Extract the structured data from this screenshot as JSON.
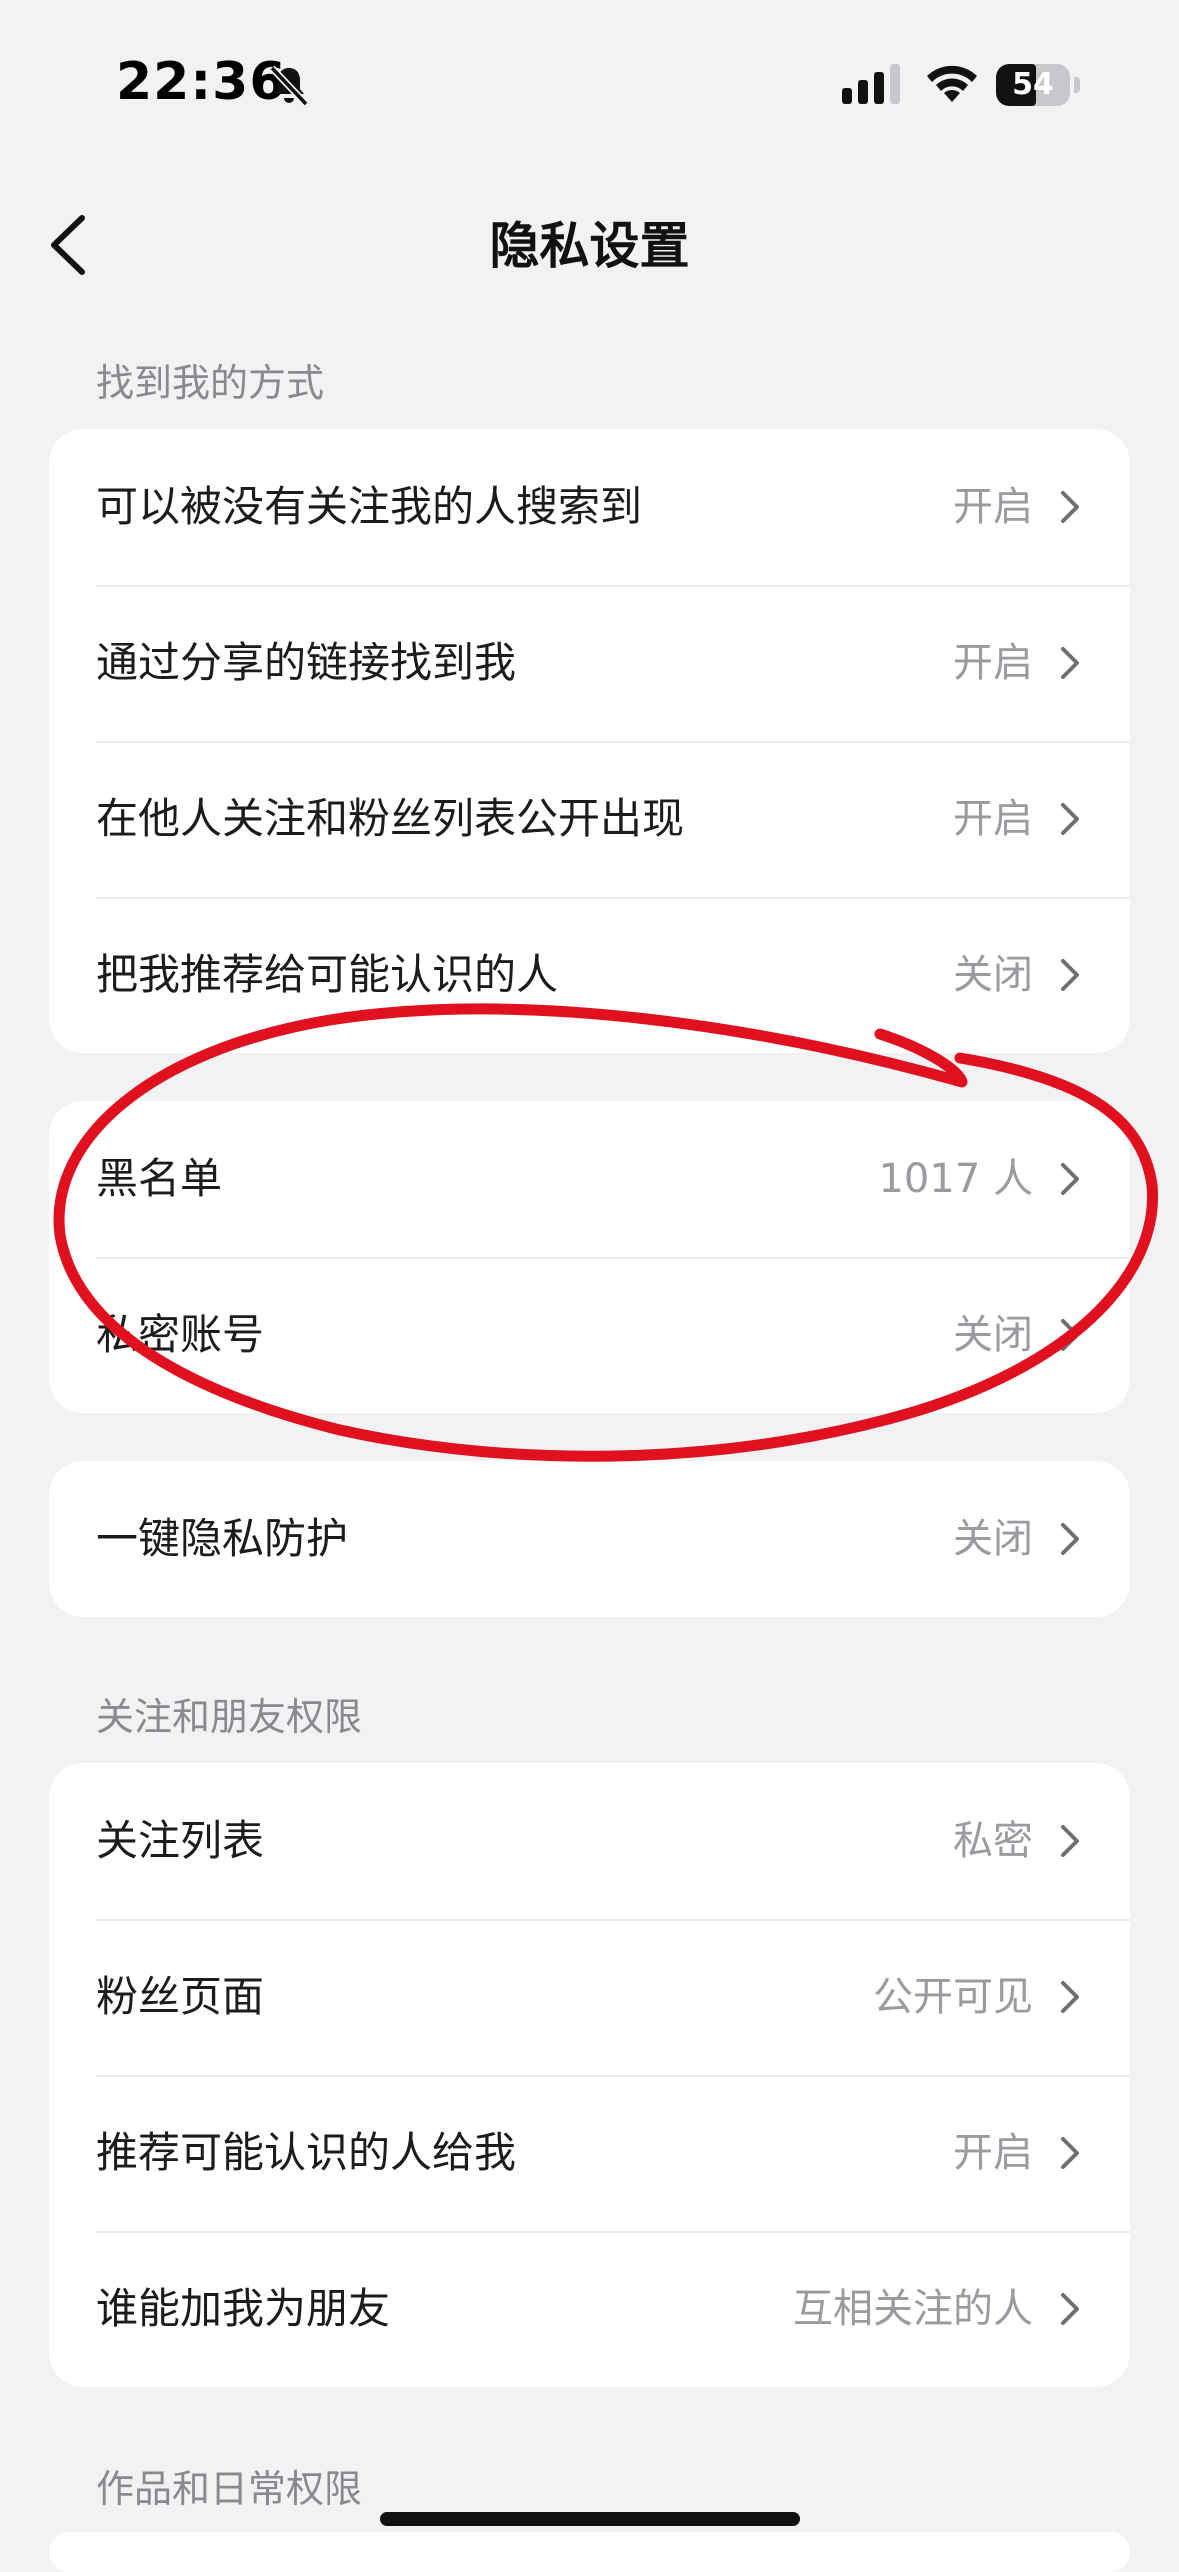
{
  "status_bar": {
    "time": "22:36",
    "battery_percent": "54",
    "battery_level": 0.54,
    "icons": [
      "bell-slash-icon",
      "signal-icon",
      "wifi-icon",
      "battery-icon"
    ]
  },
  "nav": {
    "title": "隐私设置",
    "back_icon": "chevron-left-icon"
  },
  "sections": {
    "find_me": {
      "header": "找到我的方式",
      "rows": [
        {
          "label": "可以被没有关注我的人搜索到",
          "value": "开启"
        },
        {
          "label": "通过分享的链接找到我",
          "value": "开启"
        },
        {
          "label": "在他人关注和粉丝列表公开出现",
          "value": "开启"
        },
        {
          "label": "把我推荐给可能认识的人",
          "value": "关闭"
        }
      ]
    },
    "blocklist": {
      "rows": [
        {
          "label": "黑名单",
          "value": "1017 人"
        },
        {
          "label": "私密账号",
          "value": "关闭"
        }
      ]
    },
    "protection": {
      "rows": [
        {
          "label": "一键隐私防护",
          "value": "关闭"
        }
      ]
    },
    "follow_friends": {
      "header": "关注和朋友权限",
      "rows": [
        {
          "label": "关注列表",
          "value": "私密"
        },
        {
          "label": "粉丝页面",
          "value": "公开可见"
        },
        {
          "label": "推荐可能认识的人给我",
          "value": "开启"
        },
        {
          "label": "谁能加我为朋友",
          "value": "互相关注的人"
        }
      ]
    },
    "works": {
      "header": "作品和日常权限"
    }
  },
  "colors": {
    "background": "#f2f2f4",
    "card": "#ffffff",
    "value_text": "#9a9aa0",
    "annotation": "#e0101e"
  }
}
